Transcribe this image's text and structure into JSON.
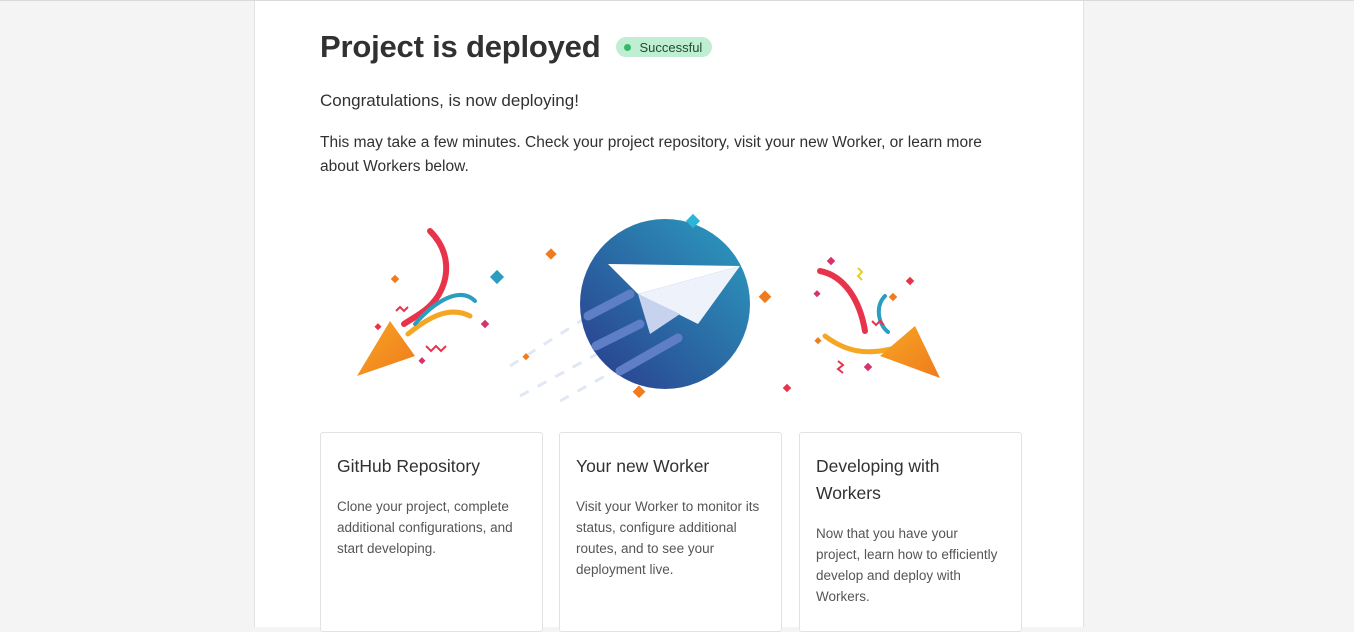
{
  "header": {
    "title": "Project is deployed",
    "status_badge": "Successful"
  },
  "main": {
    "congrats": "Congratulations, is now deploying!",
    "description": "This may take a few minutes. Check your project repository, visit your new Worker, or learn more about Workers below."
  },
  "illustration": {
    "icon": "paper-plane-icon",
    "decorations": [
      "party-popper-icon",
      "confetti"
    ]
  },
  "cards": [
    {
      "title": "GitHub Repository",
      "body": "Clone your project, complete additional configurations, and start developing."
    },
    {
      "title": "Your new Worker",
      "body": "Visit your Worker to monitor its status, configure additional routes, and to see your deployment live."
    },
    {
      "title": "Developing with Workers",
      "body": "Now that you have your project, learn how to efficiently develop and deploy with Workers."
    }
  ],
  "colors": {
    "badge_bg": "#bfeed2",
    "badge_dot": "#37b86a",
    "plane_circle_start": "#2a3a8c",
    "plane_circle_end": "#2b9ec0"
  }
}
